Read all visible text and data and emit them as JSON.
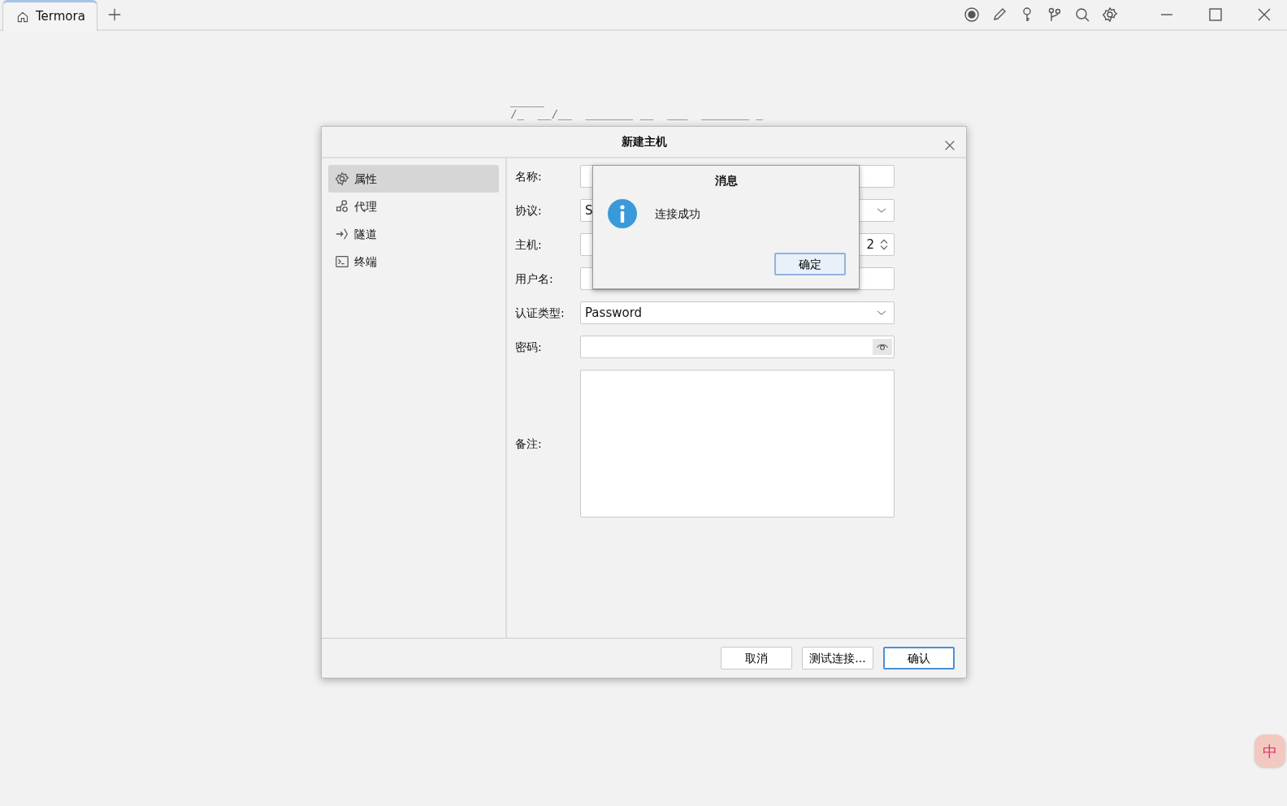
{
  "tabs": [
    {
      "label": "Termora",
      "selected": true
    }
  ],
  "background_art": [
    "_____",
    "/_  __/__  _______ __  ___  _______ _"
  ],
  "dialog": {
    "title": "新建主机",
    "sidebar": [
      {
        "label": "属性",
        "kind": "gear",
        "selected": true
      },
      {
        "label": "代理",
        "kind": "proxy",
        "selected": false
      },
      {
        "label": "隧道",
        "kind": "tunnel",
        "selected": false
      },
      {
        "label": "终端",
        "kind": "terminal",
        "selected": false
      }
    ],
    "form": [
      {
        "label": "名称:",
        "kind": "text"
      },
      {
        "label": "协议:",
        "kind": "select",
        "value": "S"
      },
      {
        "label": "主机:",
        "kind": "host",
        "port": "2"
      },
      {
        "label": "用户名:",
        "kind": "text"
      },
      {
        "label": "认证类型:",
        "kind": "select",
        "value": "Password"
      },
      {
        "label": "密码:",
        "kind": "password"
      },
      {
        "label": "备注:",
        "kind": "textarea"
      }
    ],
    "buttons": [
      {
        "label": "取消",
        "primary": false
      },
      {
        "label": "测试连接...",
        "primary": false
      },
      {
        "label": "确认",
        "primary": true
      }
    ]
  },
  "message_box": {
    "title": "消息",
    "text": "连接成功",
    "button": "确定"
  },
  "ime_indicator": "中"
}
